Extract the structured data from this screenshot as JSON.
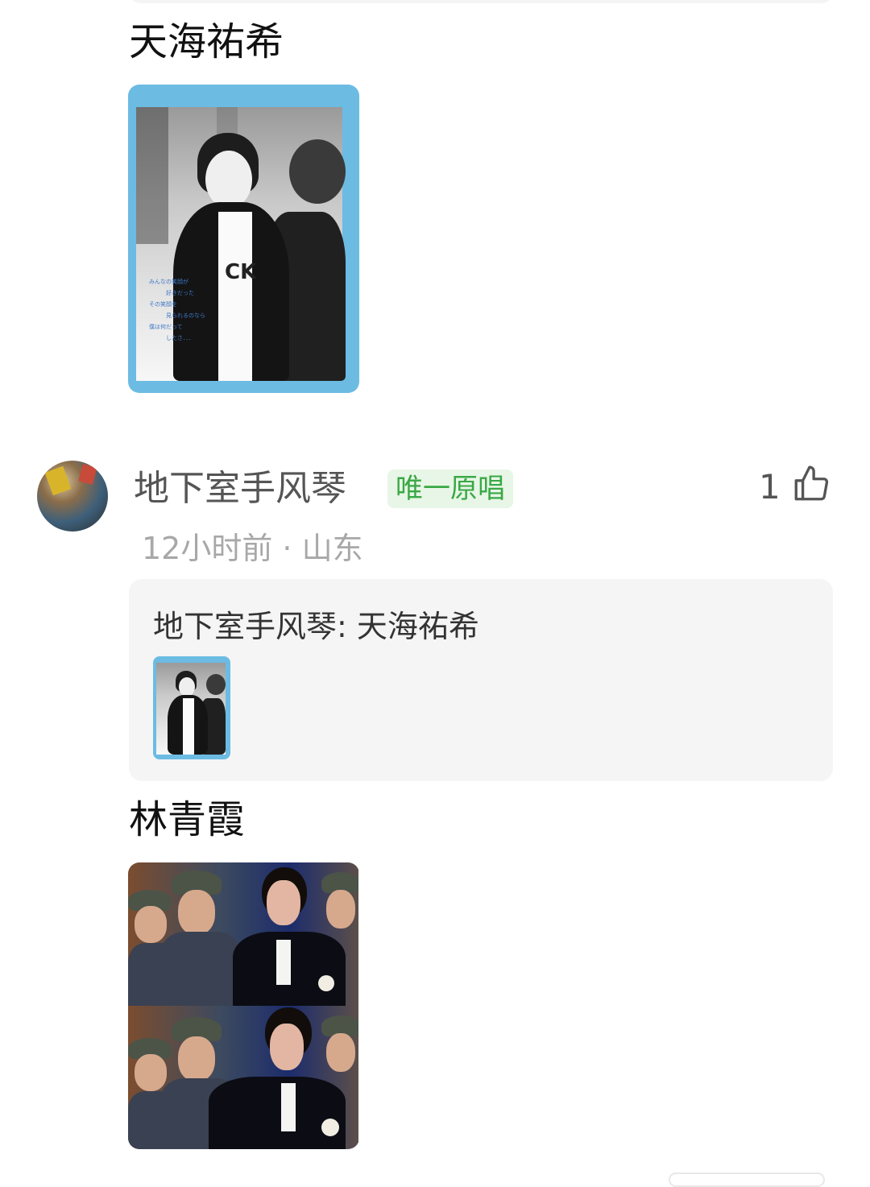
{
  "post1": {
    "caption": "天海祐希"
  },
  "post1_image": {
    "jp_text": "みんなの笑顔が\n　　　好きだった\nその笑顔を\n　　　見られるのなら\n僕は何だって\n　　　したさ．．．",
    "shirt_text": "CK"
  },
  "comment": {
    "username": "地下室手风琴",
    "badge": "唯一原唱",
    "like_count": "1",
    "meta": "12小时前 · 山东",
    "reply": "地下室手风琴: 天海祐希",
    "caption": "林青霞"
  },
  "colors": {
    "accent_green": "#3aa845",
    "badge_bg": "#e7f6e6",
    "frame_blue": "#6cbbe3"
  },
  "icons": [
    "thumbs-up-icon"
  ]
}
